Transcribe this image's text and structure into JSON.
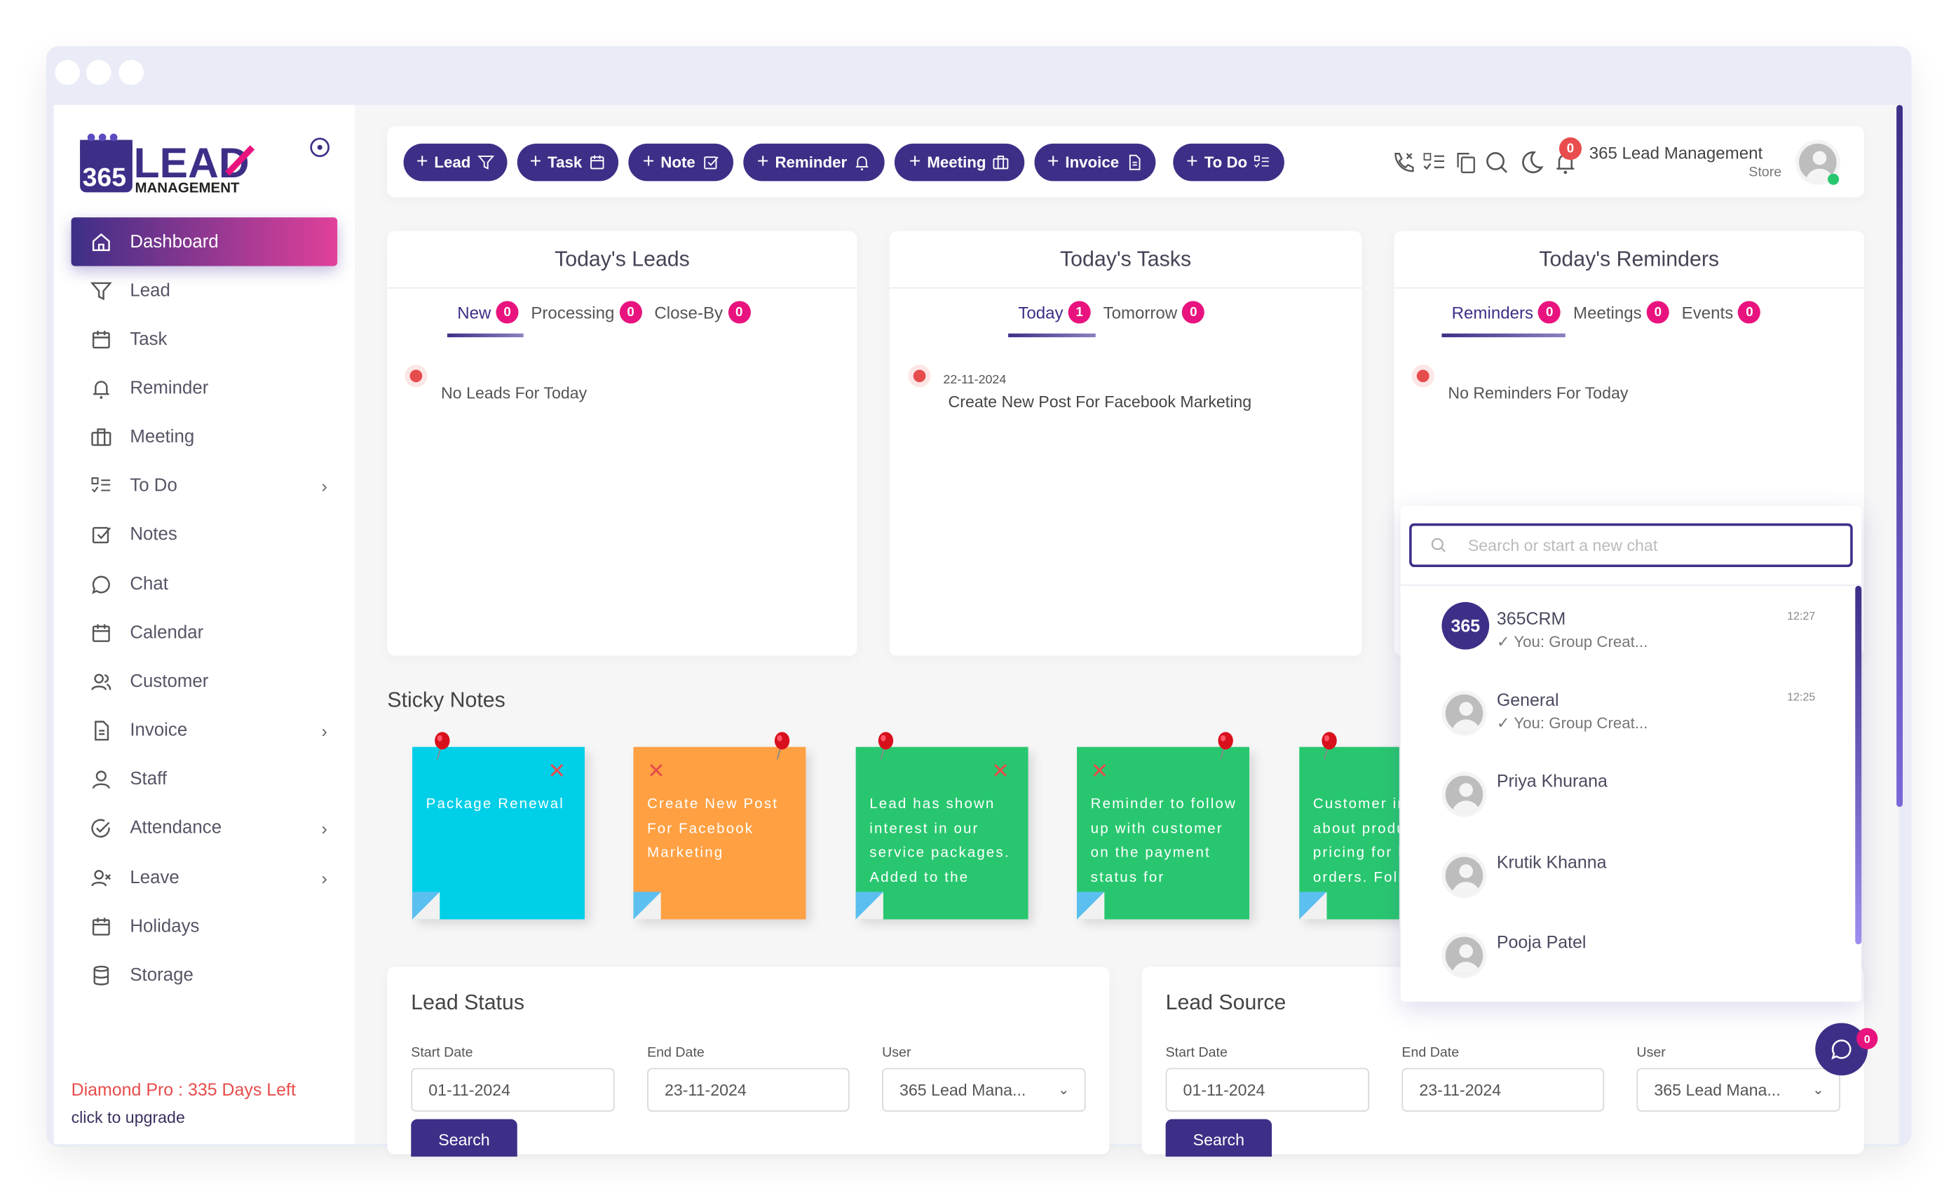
{
  "colors": {
    "primary": "#3d2f87",
    "accent": "#e8137e",
    "danger": "#e84c4c",
    "note_blue": "#00cfe8",
    "note_orange": "#ffa042",
    "note_green": "#28c76f"
  },
  "brand": {
    "logo_text": "365 LEAD MANAGEMENT"
  },
  "sidebar": {
    "items": [
      {
        "label": "Dashboard",
        "icon": "home-icon",
        "active": true
      },
      {
        "label": "Lead",
        "icon": "funnel-icon"
      },
      {
        "label": "Task",
        "icon": "calendar-icon"
      },
      {
        "label": "Reminder",
        "icon": "bell-icon"
      },
      {
        "label": "Meeting",
        "icon": "briefcase-icon"
      },
      {
        "label": "To Do",
        "icon": "checklist-icon",
        "submenu": true
      },
      {
        "label": "Notes",
        "icon": "edit-check-icon"
      },
      {
        "label": "Chat",
        "icon": "chat-icon"
      },
      {
        "label": "Calendar",
        "icon": "calendar-icon"
      },
      {
        "label": "Customer",
        "icon": "users-icon"
      },
      {
        "label": "Invoice",
        "icon": "document-icon",
        "submenu": true
      },
      {
        "label": "Staff",
        "icon": "user-icon"
      },
      {
        "label": "Attendance",
        "icon": "check-circle-icon",
        "submenu": true
      },
      {
        "label": "Leave",
        "icon": "user-x-icon",
        "submenu": true
      },
      {
        "label": "Holidays",
        "icon": "calendar-icon"
      },
      {
        "label": "Storage",
        "icon": "database-icon"
      }
    ],
    "plan_text": "Diamond Pro : 335 Days Left",
    "upgrade_text": "click to upgrade"
  },
  "toolbar": {
    "buttons": [
      {
        "label": "Lead",
        "icon": "funnel-icon"
      },
      {
        "label": "Task",
        "icon": "calendar-icon"
      },
      {
        "label": "Note",
        "icon": "edit-check-icon"
      },
      {
        "label": "Reminder",
        "icon": "bell-icon"
      },
      {
        "label": "Meeting",
        "icon": "briefcase-icon"
      },
      {
        "label": "Invoice",
        "icon": "document-icon"
      },
      {
        "label": "To Do",
        "icon": "checklist-icon"
      }
    ],
    "notification_count": "0",
    "user_name": "365 Lead Management",
    "user_role": "Store"
  },
  "leads": {
    "title": "Today's Leads",
    "tabs": [
      {
        "label": "New",
        "count": "0"
      },
      {
        "label": "Processing",
        "count": "0"
      },
      {
        "label": "Close-By",
        "count": "0"
      }
    ],
    "empty": "No Leads For Today"
  },
  "tasks": {
    "title": "Today's Tasks",
    "tabs": [
      {
        "label": "Today",
        "count": "1"
      },
      {
        "label": "Tomorrow",
        "count": "0"
      }
    ],
    "item_date": "22-11-2024",
    "item_text": "Create New Post For Facebook Marketing"
  },
  "reminders": {
    "title": "Today's Reminders",
    "tabs": [
      {
        "label": "Reminders",
        "count": "0"
      },
      {
        "label": "Meetings",
        "count": "0"
      },
      {
        "label": "Events",
        "count": "0"
      }
    ],
    "empty": "No Reminders For Today"
  },
  "sticky": {
    "title": "Sticky Notes",
    "notes": [
      {
        "text": "Package Renewal",
        "color": "#00cfe8"
      },
      {
        "text": "Create New Post For Facebook Marketing",
        "color": "#ffa042"
      },
      {
        "text": "Lead has shown interest in our service packages. Added to the",
        "color": "#28c76f"
      },
      {
        "text": "Reminder to follow up with customer on the payment status for",
        "color": "#28c76f"
      },
      {
        "text": "Customer inquired about product pricing for bulk orders. Follow-up",
        "color": "#28c76f"
      }
    ]
  },
  "chat": {
    "search_placeholder": "Search or start a new chat",
    "items": [
      {
        "name": "365CRM",
        "msg": "You: Group Creat...",
        "time": "12:27"
      },
      {
        "name": "General",
        "msg": "You: Group Creat...",
        "time": "12:25"
      },
      {
        "name": "Priya Khurana"
      },
      {
        "name": "Krutik Khanna"
      },
      {
        "name": "Pooja Patel"
      }
    ],
    "unread": "0"
  },
  "lead_status": {
    "title": "Lead Status",
    "start_label": "Start Date",
    "start": "01-11-2024",
    "end_label": "End Date",
    "end": "23-11-2024",
    "user_label": "User",
    "user": "365 Lead Mana...",
    "search": "Search"
  },
  "lead_source": {
    "title": "Lead Source",
    "start_label": "Start Date",
    "start": "01-11-2024",
    "end_label": "End Date",
    "end": "23-11-2024",
    "user_label": "User",
    "user": "365 Lead Mana...",
    "search": "Search"
  }
}
